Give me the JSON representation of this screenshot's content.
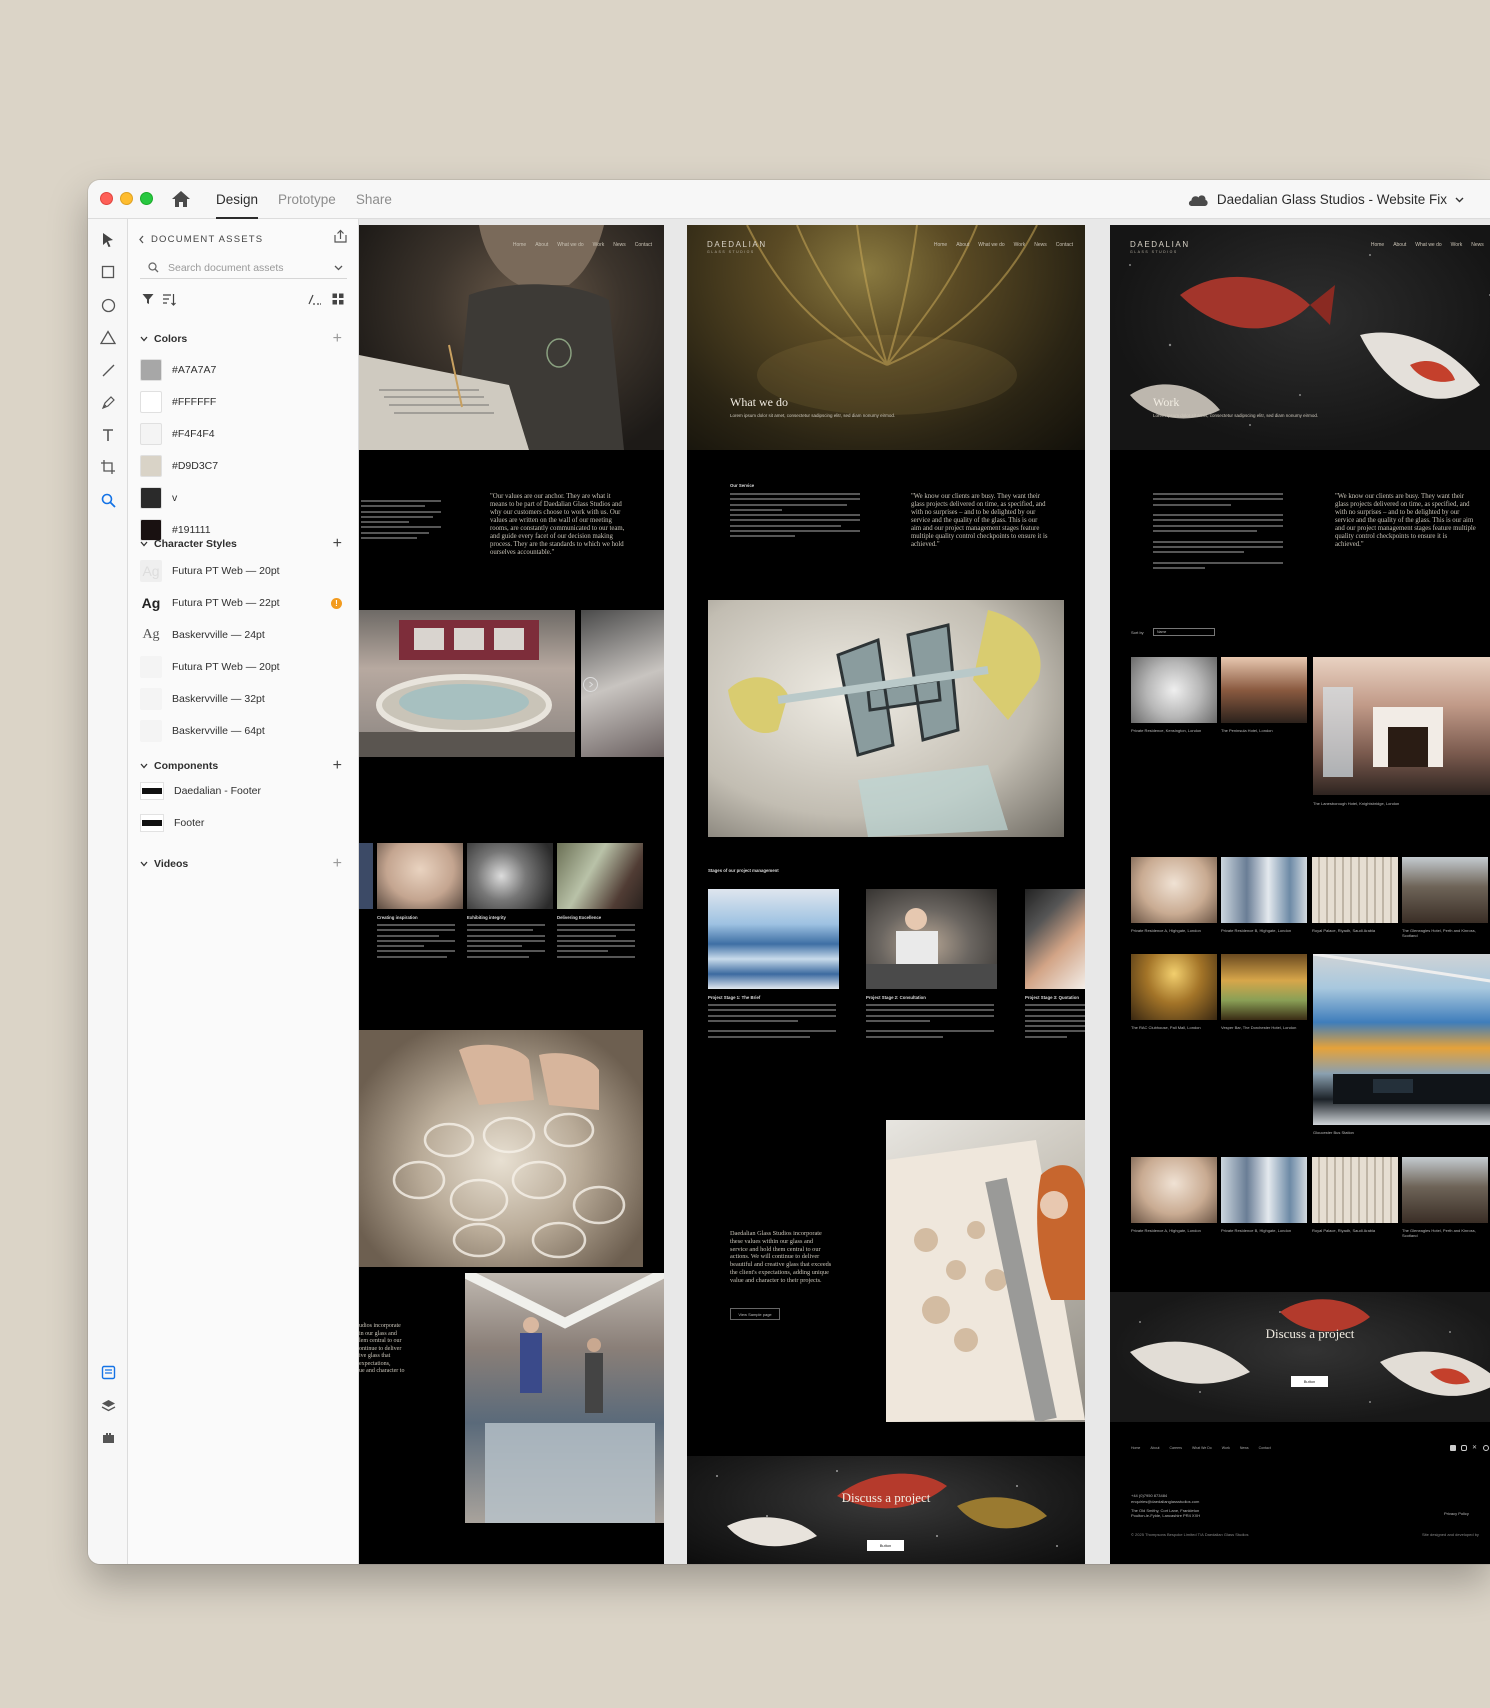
{
  "app": {
    "tabs": [
      "Design",
      "Prototype",
      "Share"
    ],
    "active_tab": "Design",
    "document_title": "Daedalian Glass Studios - Website Fix"
  },
  "assets": {
    "header": "DOCUMENT ASSETS",
    "search_placeholder": "Search document assets",
    "colors": {
      "title": "Colors",
      "items": [
        {
          "hex": "#A7A7A7",
          "label": "#A7A7A7"
        },
        {
          "hex": "#FFFFFF",
          "label": "#FFFFFF"
        },
        {
          "hex": "#F4F4F4",
          "label": "#F4F4F4"
        },
        {
          "hex": "#D9D3C7",
          "label": "#D9D3C7"
        },
        {
          "hex": "#2A2A2A",
          "label": "v"
        },
        {
          "hex": "#191111",
          "label": "#191111"
        }
      ]
    },
    "character_styles": {
      "title": "Character Styles",
      "items": [
        {
          "label": "Futura PT Web — 20pt",
          "preview": "Ag",
          "style": "faint"
        },
        {
          "label": "Futura PT Web — 22pt",
          "preview": "Ag",
          "style": "bold",
          "warning": "!"
        },
        {
          "label": "Baskervville — 24pt",
          "preview": "Ag",
          "style": "serif"
        },
        {
          "label": "Futura PT Web — 20pt",
          "preview": "",
          "style": "blank"
        },
        {
          "label": "Baskervville — 32pt",
          "preview": "",
          "style": "blank"
        },
        {
          "label": "Baskervville — 64pt",
          "preview": "",
          "style": "blank"
        }
      ]
    },
    "components": {
      "title": "Components",
      "items": [
        "Daedalian - Footer",
        "Footer"
      ]
    },
    "videos": {
      "title": "Videos"
    }
  },
  "boards": {
    "nav": [
      "Home",
      "About",
      "What we do",
      "Work",
      "News",
      "Contact"
    ],
    "logo": {
      "name": "DAEDALIAN",
      "sub": "GLASS STUDIOS"
    },
    "board1": {
      "quote": "\"Our values are our anchor. They are what it means to be part of Daedalian Glass Studios and why our customers choose to work with us. Our values are written on the wall of our meeting rooms, are constantly communicated to our team, and guide every facet of our decision making process. They are the standards to which we hold ourselves accountable.\"",
      "values": [
        "Creating inspiration",
        "Exhibiting integrity",
        "Delivering Excellence"
      ],
      "closing": "udios incorporate\nin our glass and\nlem central to our\nontinue to deliver\nive glass that\nexpectations,\nue and character to"
    },
    "board2": {
      "hero_title": "What we do",
      "hero_sub": "Lorem ipsum dolor sit amet, consectetur sadipscing elitr, sed diam nonumy eirmod.",
      "service_heading": "Our Service",
      "quote": "\"We know our clients are busy. They want their glass projects delivered on time, as specified, and with no surprises – and to be delighted by our service and the quality of the glass. This is our aim and our project management stages feature multiple quality control checkpoints to ensure it is achieved.\"",
      "stages_heading": "Stages of our project management",
      "stages": [
        "Project Stage 1: The Brief",
        "Project Stage 2: Consultation",
        "Project Stage 3: Quotation"
      ],
      "closing": "Daedalian Glass Studios incorporate these values within our glass and service and hold them central to our actions. We will continue to deliver beautiful and creative glass that exceeds the client's expectations, adding unique value and character to their projects.",
      "sample_button": "View Sample page",
      "discuss": "Discuss a project",
      "discuss_button": "Button"
    },
    "board3": {
      "hero_title": "Work",
      "hero_sub": "Lorem ipsum dolor sit amet, consectetur sadipscing elitr, sed diam nonumy eirmod.",
      "quote": "\"We know our clients are busy. They want their glass projects delivered on time, as specified, and with no surprises – and to be delighted by our service and the quality of the glass. This is our aim and our project management stages feature multiple quality control checkpoints to ensure it is achieved.\"",
      "sort_label": "Sort by",
      "sort_value": "Name",
      "captions_row1": [
        "Private Residence, Kensington, London",
        "The Peninsula Hotel, London",
        "The Lanesborough Hotel, Knightsbridge, London"
      ],
      "captions_row2": [
        "Private Residence A, Highgate, London",
        "Private Residence B, Highgate, London",
        "Royal Palace, Riyadh, Saudi Arabia",
        "The Gleneagles Hotel, Perth and Kinross, Scotland"
      ],
      "captions_row3": [
        "The RAC Clubhouse, Pall Mall, London",
        "Vesper Bar, The Dorchester Hotel, London",
        "Gloucester Bus Station"
      ],
      "captions_row4": [
        "Private Residence A, Highgate, London",
        "Private Residence B, Highgate, London",
        "Royal Palace, Riyadh, Saudi Arabia",
        "The Gleneagles Hotel, Perth and Kinross, Scotland"
      ],
      "discuss": "Discuss a project",
      "discuss_button": "Button",
      "footer_nav": [
        "Home",
        "About",
        "Careers",
        "What We Do",
        "Work",
        "News",
        "Contact"
      ],
      "footer_phone": "+44 (0)7950 873484",
      "footer_email": "enquiries@daedalianglassstudios.com",
      "footer_address": "The Old Smithy, Cort Lane, Frankleton\nPoulton-le-Fylde, Lancashire PR4 XXH",
      "footer_policy": "Privacy Policy",
      "footer_copy": "© 2025 Thompsons Bespoke Limited T/A Daedalian Glass Studios",
      "footer_credit": "Site designed and developed by"
    }
  }
}
